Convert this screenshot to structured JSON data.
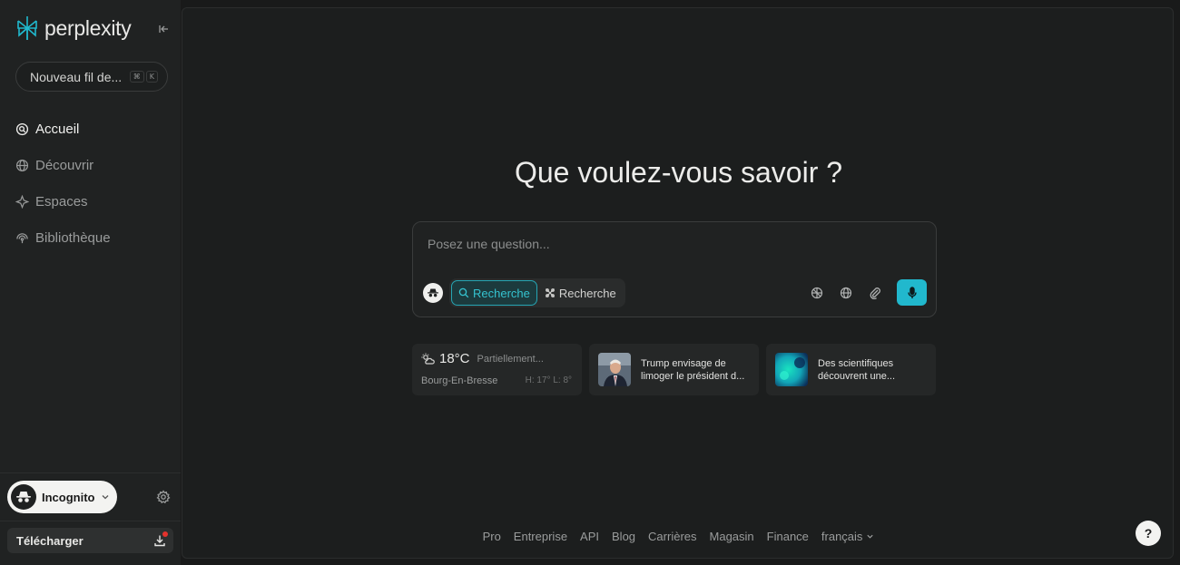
{
  "sidebar": {
    "brand": "perplexity",
    "new_thread": {
      "label": "Nouveau fil de...",
      "shortcut": [
        "⌘",
        "K"
      ]
    },
    "nav": [
      {
        "label": "Accueil",
        "icon": "search-circle-icon",
        "active": true
      },
      {
        "label": "Découvrir",
        "icon": "globe-icon",
        "active": false
      },
      {
        "label": "Espaces",
        "icon": "spaces-icon",
        "active": false
      },
      {
        "label": "Bibliothèque",
        "icon": "library-icon",
        "active": false
      }
    ],
    "incognito_label": "Incognito",
    "download_label": "Télécharger"
  },
  "main": {
    "heading": "Que voulez-vous savoir ?",
    "search": {
      "placeholder": "Posez une question...",
      "mode_active": "Recherche",
      "mode_inactive": "Recherche"
    },
    "weather": {
      "temp": "18°C",
      "description": "Partiellement...",
      "city": "Bourg-En-Bresse",
      "high_low": "H: 17° L: 8°"
    },
    "news": [
      {
        "title": "Trump envisage de limoger le président d..."
      },
      {
        "title": "Des scientifiques découvrent une..."
      }
    ],
    "footer_links": [
      "Pro",
      "Entreprise",
      "API",
      "Blog",
      "Carrières",
      "Magasin",
      "Finance",
      "français"
    ],
    "help": "?"
  },
  "colors": {
    "accent": "#21b8cd",
    "background": "#191a1a",
    "panel": "#1c1e1e"
  }
}
